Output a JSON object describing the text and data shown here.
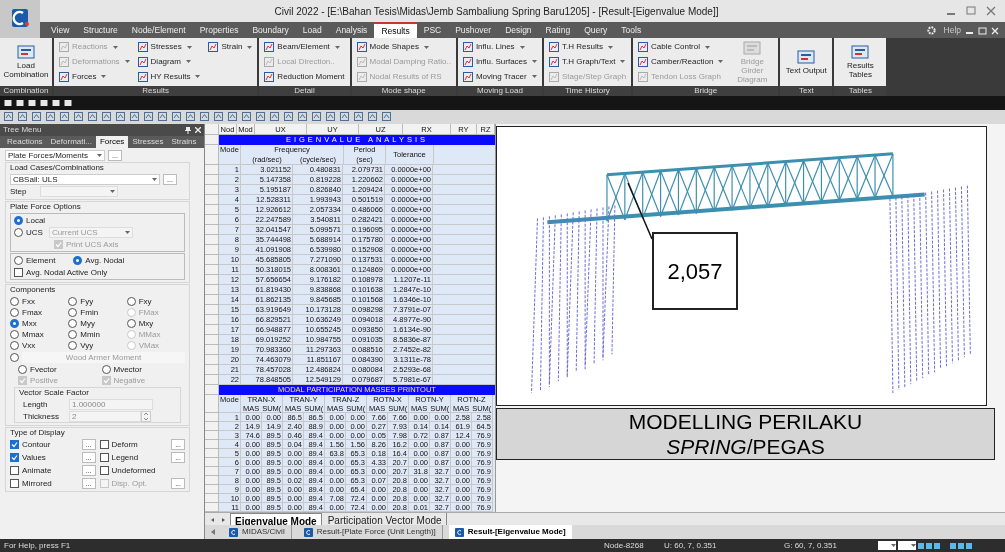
{
  "window": {
    "title": "Civil 2022 - [E:\\Bahan Tesis\\Midas\\Jemb Sambaliung Spring Baru1205] - [Result-[Eigenvalue Mode]]"
  },
  "menu_tabs": [
    {
      "label": "View",
      "selected": false
    },
    {
      "label": "Structure",
      "selected": false
    },
    {
      "label": "Node/Element",
      "selected": false
    },
    {
      "label": "Properties",
      "selected": false
    },
    {
      "label": "Boundary",
      "selected": false
    },
    {
      "label": "Load",
      "selected": false
    },
    {
      "label": "Analysis",
      "selected": false
    },
    {
      "label": "Results",
      "selected": true
    },
    {
      "label": "PSC",
      "selected": false
    },
    {
      "label": "Pushover",
      "selected": false
    },
    {
      "label": "Design",
      "selected": false
    },
    {
      "label": "Rating",
      "selected": false
    },
    {
      "label": "Query",
      "selected": false
    },
    {
      "label": "Tools",
      "selected": false
    }
  ],
  "help_label": "Help",
  "ribbon_groups": [
    {
      "label": "Combination",
      "items": [
        {
          "label": "Load Combination",
          "kind": "large",
          "disabled": false,
          "dropdown": false
        }
      ]
    },
    {
      "label": "Results",
      "items": [
        {
          "label": "Reactions",
          "kind": "small",
          "disabled": true,
          "dropdown": true
        },
        {
          "label": "Deformations",
          "kind": "small",
          "disabled": true,
          "dropdown": true
        },
        {
          "label": "Forces",
          "kind": "small",
          "disabled": false,
          "dropdown": true
        },
        {
          "label": "Stresses",
          "kind": "small",
          "disabled": false,
          "dropdown": true
        },
        {
          "label": "Diagram",
          "kind": "small",
          "disabled": false,
          "dropdown": true
        },
        {
          "label": "HY Results",
          "kind": "small",
          "disabled": false,
          "dropdown": true
        },
        {
          "label": "Strain",
          "kind": "small",
          "disabled": false,
          "dropdown": true
        }
      ]
    },
    {
      "label": "Detail",
      "items": [
        {
          "label": "Beam/Element",
          "kind": "small",
          "disabled": false,
          "dropdown": true
        },
        {
          "label": "Local Direction..",
          "kind": "small",
          "disabled": true,
          "dropdown": false
        },
        {
          "label": "Reduction Moment",
          "kind": "small",
          "disabled": false,
          "dropdown": false
        }
      ]
    },
    {
      "label": "Mode shape",
      "items": [
        {
          "label": "Mode Shapes",
          "kind": "small",
          "disabled": false,
          "dropdown": true
        },
        {
          "label": "Modal Damping Ratio..",
          "kind": "small",
          "disabled": true,
          "dropdown": false
        },
        {
          "label": "Nodal Results of RS",
          "kind": "small",
          "disabled": true,
          "dropdown": false
        }
      ]
    },
    {
      "label": "Moving Load",
      "items": [
        {
          "label": "Influ. Lines",
          "kind": "small",
          "disabled": false,
          "dropdown": true
        },
        {
          "label": "Influ. Surfaces",
          "kind": "small",
          "disabled": false,
          "dropdown": true
        },
        {
          "label": "Moving Tracer",
          "kind": "small",
          "disabled": false,
          "dropdown": true
        }
      ]
    },
    {
      "label": "Time History",
      "items": [
        {
          "label": "T.H Results",
          "kind": "small",
          "disabled": false,
          "dropdown": true
        },
        {
          "label": "T.H Graph/Text",
          "kind": "small",
          "disabled": false,
          "dropdown": true
        },
        {
          "label": "Stage/Step Graph",
          "kind": "small",
          "disabled": true,
          "dropdown": false
        }
      ]
    },
    {
      "label": "Bridge",
      "items": [
        {
          "label": "Cable Control",
          "kind": "small",
          "disabled": false,
          "dropdown": true
        },
        {
          "label": "Camber/Reaction",
          "kind": "small",
          "disabled": false,
          "dropdown": true
        },
        {
          "label": "Tendon Loss Graph",
          "kind": "small",
          "disabled": true,
          "dropdown": false
        },
        {
          "label": "Bridge Girder Diagram",
          "kind": "large",
          "disabled": true,
          "dropdown": false
        }
      ]
    },
    {
      "label": "Text",
      "items": [
        {
          "label": "Text Output",
          "kind": "large",
          "disabled": false,
          "dropdown": false
        }
      ]
    },
    {
      "label": "Tables",
      "items": [
        {
          "label": "Results Tables",
          "kind": "large",
          "disabled": false,
          "dropdown": false
        }
      ]
    }
  ],
  "tree_menu": {
    "title": "Tree Menu",
    "tabs": [
      {
        "label": "Reactions",
        "selected": false
      },
      {
        "label": "Deformati...",
        "selected": false
      },
      {
        "label": "Forces",
        "selected": true
      },
      {
        "label": "Stresses",
        "selected": false
      },
      {
        "label": "Strains",
        "selected": false
      }
    ],
    "result_type": "Plate Forces/Moments",
    "more_button": "...",
    "load_cases": {
      "label": "Load Cases/Combinations",
      "value": "CBSall: ULS",
      "more_button": "...",
      "step_label": "Step"
    },
    "plate_force_options": {
      "label": "Plate Force Options",
      "coordinates": [
        {
          "label": "Local",
          "selected": true
        },
        {
          "label": "UCS",
          "selected": false
        }
      ],
      "ucs_value": "Current UCS",
      "print_ucs_axis": {
        "label": "Print UCS Axis",
        "checked": true,
        "disabled": true
      },
      "averaging": [
        {
          "label": "Element",
          "selected": false
        },
        {
          "label": "Avg. Nodal",
          "selected": true
        }
      ],
      "active_only": {
        "label": "Avg. Nodal Active Only",
        "checked": false,
        "disabled": false
      }
    },
    "components": {
      "label": "Components",
      "options": [
        {
          "label": "Fxx",
          "selected": false,
          "disabled": false
        },
        {
          "label": "Fyy",
          "selected": false,
          "disabled": false
        },
        {
          "label": "Fxy",
          "selected": false,
          "disabled": false
        },
        {
          "label": "Fmax",
          "selected": false,
          "disabled": false
        },
        {
          "label": "Fmin",
          "selected": false,
          "disabled": false
        },
        {
          "label": "FMax",
          "selected": false,
          "disabled": true
        },
        {
          "label": "Mxx",
          "selected": true,
          "disabled": false
        },
        {
          "label": "Myy",
          "selected": false,
          "disabled": false
        },
        {
          "label": "Mxy",
          "selected": false,
          "disabled": false
        },
        {
          "label": "Mmax",
          "selected": false,
          "disabled": false
        },
        {
          "label": "Mmin",
          "selected": false,
          "disabled": false
        },
        {
          "label": "MMax",
          "selected": false,
          "disabled": true
        },
        {
          "label": "Vxx",
          "selected": false,
          "disabled": false
        },
        {
          "label": "Vyy",
          "selected": false,
          "disabled": false
        },
        {
          "label": "VMax",
          "selected": false,
          "disabled": true
        }
      ],
      "wood_armer": {
        "label": "Wood Armer Moment",
        "selected": false,
        "disabled": true
      },
      "vectors": [
        {
          "label": "Fvector",
          "selected": false
        },
        {
          "label": "Mvector",
          "selected": false
        }
      ],
      "signs": [
        {
          "label": "Positive",
          "checked": true,
          "disabled": true
        },
        {
          "label": "Negative",
          "checked": true,
          "disabled": true
        }
      ]
    },
    "vector_scale": {
      "label": "Vector Scale Factor",
      "length_label": "Length",
      "length": "1.000000",
      "thickness_label": "Thickness",
      "thickness": "2"
    },
    "display": {
      "label": "Type of Display",
      "options": [
        {
          "label": "Contour",
          "checked": true,
          "disabled": false,
          "more": "..."
        },
        {
          "label": "Deform",
          "checked": false,
          "disabled": false,
          "more": "..."
        },
        {
          "label": "Values",
          "checked": true,
          "disabled": false,
          "more": "..."
        },
        {
          "label": "Legend",
          "checked": false,
          "disabled": false,
          "more": "..."
        },
        {
          "label": "Animate",
          "checked": false,
          "disabled": false,
          "more": "..."
        },
        {
          "label": "Undeformed",
          "checked": false,
          "disabled": false
        },
        {
          "label": "Mirrored",
          "checked": false,
          "disabled": false,
          "more": "..."
        },
        {
          "label": "Disp. Opt.",
          "checked": false,
          "disabled": true,
          "more": "..."
        }
      ]
    }
  },
  "sheet": {
    "columns": [
      "Nod",
      "Mod",
      "UX",
      "UY",
      "UZ",
      "RX",
      "RY",
      "RZ"
    ],
    "eigen": {
      "title": "EIGENVALUE ANALYSIS",
      "mode_header": "Mode",
      "frequency_header": "Frequency",
      "rad_header": "(rad/sec)",
      "cycle_header": "(cycle/sec)",
      "period_header": "Period",
      "period_unit": "(sec)",
      "tolerance_header": "Tolerance",
      "rows": [
        [
          "1",
          "3.021152",
          "0.480831",
          "2.079731",
          "0.0000e+00"
        ],
        [
          "2",
          "5.147358",
          "0.819228",
          "1.220662",
          "0.0000e+00"
        ],
        [
          "3",
          "5.195187",
          "0.826840",
          "1.209424",
          "0.0000e+00"
        ],
        [
          "4",
          "12.528311",
          "1.993943",
          "0.501519",
          "0.0000e+00"
        ],
        [
          "5",
          "12.926612",
          "2.057334",
          "0.486066",
          "0.0000e+00"
        ],
        [
          "6",
          "22.247589",
          "3.540811",
          "0.282421",
          "0.0000e+00"
        ],
        [
          "7",
          "32.041547",
          "5.099571",
          "0.196095",
          "0.0000e+00"
        ],
        [
          "8",
          "35.744498",
          "5.688914",
          "0.175780",
          "0.0000e+00"
        ],
        [
          "9",
          "41.091908",
          "6.539980",
          "0.152908",
          "0.0000e+00"
        ],
        [
          "10",
          "45.685805",
          "7.271090",
          "0.137531",
          "0.0000e+00"
        ],
        [
          "11",
          "50.318015",
          "8.008361",
          "0.124869",
          "0.0000e+00"
        ],
        [
          "12",
          "57.656654",
          "9.176182",
          "0.108978",
          "1.1207e-11"
        ],
        [
          "13",
          "61.819430",
          "9.838868",
          "0.101638",
          "1.2847e-10"
        ],
        [
          "14",
          "61.862135",
          "9.845685",
          "0.101568",
          "1.6346e-10"
        ],
        [
          "15",
          "63.919649",
          "10.173128",
          "0.098298",
          "7.3791e-07"
        ],
        [
          "16",
          "66.829521",
          "10.636249",
          "0.094018",
          "4.8977e-90"
        ],
        [
          "17",
          "66.948877",
          "10.655245",
          "0.093850",
          "1.6134e-90"
        ],
        [
          "18",
          "69.019252",
          "10.984755",
          "0.091035",
          "8.5836e-87"
        ],
        [
          "19",
          "70.983360",
          "11.297363",
          "0.088516",
          "2.7452e-82"
        ],
        [
          "20",
          "74.463079",
          "11.851167",
          "0.084390",
          "3.1311e-78"
        ],
        [
          "21",
          "78.457028",
          "12.486824",
          "0.080084",
          "2.5293e-68"
        ],
        [
          "22",
          "78.848505",
          "12.549129",
          "0.079687",
          "5.7981e-67"
        ]
      ]
    },
    "participation": {
      "title": "MODAL PARTICIPATION MASSES PRINTOUT",
      "mode_header": "Mode",
      "groups": [
        {
          "label": "TRAN-X",
          "sub_headers": [
            "MAS",
            "SUM("
          ]
        },
        {
          "label": "TRAN-Y",
          "sub_headers": [
            "MAS",
            "SUM("
          ]
        },
        {
          "label": "TRAN-Z",
          "sub_headers": [
            "MAS",
            "SUM("
          ]
        },
        {
          "label": "ROTN-X",
          "sub_headers": [
            "MAS",
            "SUM("
          ]
        },
        {
          "label": "ROTN-Y",
          "sub_headers": [
            "MAS",
            "SUM("
          ]
        },
        {
          "label": "ROTN-Z",
          "sub_headers": [
            "MAS",
            "SUM("
          ]
        }
      ],
      "rows": [
        [
          "1",
          "0.00",
          "0.00",
          "86.5",
          "86.5",
          "0.00",
          "0.00",
          "7.66",
          "7.66",
          "0.00",
          "0.00",
          "2.58",
          "2.58"
        ],
        [
          "2",
          "14.9",
          "14.9",
          "2.40",
          "88.9",
          "0.00",
          "0.00",
          "0.27",
          "7.93",
          "0.14",
          "0.14",
          "61.9",
          "64.5"
        ],
        [
          "3",
          "74.6",
          "89.5",
          "0.46",
          "89.4",
          "0.00",
          "0.00",
          "0.05",
          "7.98",
          "0.72",
          "0.87",
          "12.4",
          "76.9"
        ],
        [
          "4",
          "0.00",
          "89.5",
          "0.04",
          "89.4",
          "1.56",
          "1.56",
          "8.26",
          "16.2",
          "0.00",
          "0.87",
          "0.00",
          "76.9"
        ],
        [
          "5",
          "0.00",
          "89.5",
          "0.00",
          "89.4",
          "63.8",
          "65.3",
          "0.18",
          "16.4",
          "0.00",
          "0.87",
          "0.00",
          "76.9"
        ],
        [
          "6",
          "0.00",
          "89.5",
          "0.00",
          "89.4",
          "0.00",
          "65.3",
          "4.33",
          "20.7",
          "0.00",
          "0.87",
          "0.00",
          "76.9"
        ],
        [
          "7",
          "0.00",
          "89.5",
          "0.00",
          "89.4",
          "0.00",
          "65.3",
          "0.00",
          "20.7",
          "31.8",
          "32.7",
          "0.00",
          "76.9"
        ],
        [
          "8",
          "0.00",
          "89.5",
          "0.02",
          "89.4",
          "0.00",
          "65.3",
          "0.07",
          "20.8",
          "0.00",
          "32.7",
          "0.00",
          "76.9"
        ],
        [
          "9",
          "0.00",
          "89.5",
          "0.00",
          "89.4",
          "0.00",
          "65.4",
          "0.00",
          "20.8",
          "0.00",
          "32.7",
          "0.00",
          "76.9"
        ],
        [
          "10",
          "0.00",
          "89.5",
          "0.00",
          "89.4",
          "7.08",
          "72.4",
          "0.00",
          "20.8",
          "0.00",
          "32.7",
          "0.00",
          "76.9"
        ],
        [
          "11",
          "0.00",
          "89.5",
          "0.00",
          "89.4",
          "0.00",
          "72.4",
          "0.00",
          "20.8",
          "0.01",
          "32.7",
          "0.00",
          "76.9"
        ]
      ]
    },
    "tabs": [
      {
        "label": "Eigenvalue Mode",
        "selected": true
      },
      {
        "label": "Participation Vector Mode",
        "selected": false
      }
    ]
  },
  "callout": {
    "value": "2,057"
  },
  "caption": {
    "line_1": "MODELLING PERILAKU",
    "line_2": "*SPRING*/PEGAS"
  },
  "document_tabs": [
    {
      "label": "MIDAS/Civil",
      "selected": false
    },
    {
      "label": "Result-[Plate Force (Unit Length)]",
      "selected": false
    },
    {
      "label": "Result-[Eigenvalue Mode]",
      "selected": true
    }
  ],
  "status_bar": {
    "help": "For Help, press F1",
    "node": "Node-8268",
    "ucs": "U: 60, 7, 0.351",
    "gcs": "G: 60, 7, 0.351"
  }
}
